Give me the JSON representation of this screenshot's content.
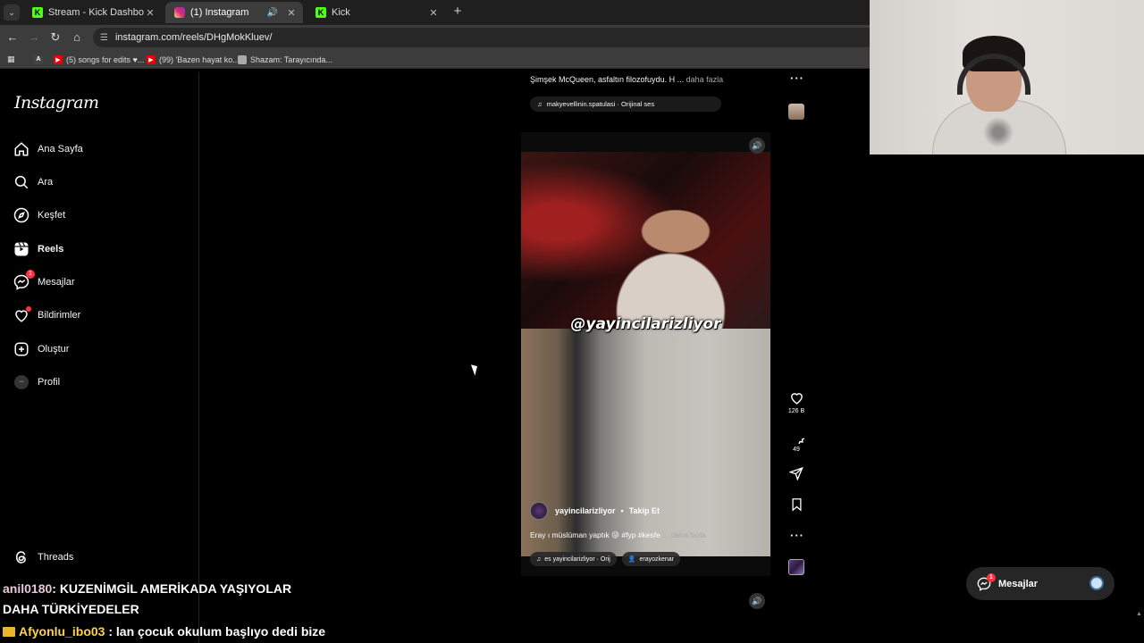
{
  "browser": {
    "tabs": [
      {
        "title": "Stream - Kick Dashboard",
        "favicon": "kick-icon",
        "active": false
      },
      {
        "title": "(1) Instagram",
        "favicon": "instagram-icon",
        "active": true
      },
      {
        "title": "Kick",
        "favicon": "kick-icon",
        "active": false
      }
    ],
    "url": "instagram.com/reels/DHgMokKluev/",
    "bookmarks": [
      {
        "label": "(5) songs for edits ♥...",
        "icon": "youtube-icon"
      },
      {
        "label": "(99) 'Bazen hayat ko...",
        "icon": "youtube-icon"
      },
      {
        "label": "Shazam: Tarayıcında...",
        "icon": "shazam-icon"
      }
    ]
  },
  "sidebar": {
    "logo": "Instagram",
    "items": [
      {
        "label": "Ana Sayfa",
        "icon": "home-icon"
      },
      {
        "label": "Ara",
        "icon": "search-icon"
      },
      {
        "label": "Keşfet",
        "icon": "compass-icon"
      },
      {
        "label": "Reels",
        "icon": "reels-icon",
        "active": true
      },
      {
        "label": "Mesajlar",
        "icon": "messenger-icon",
        "badge": "1"
      },
      {
        "label": "Bildirimler",
        "icon": "heart-icon"
      },
      {
        "label": "Oluştur",
        "icon": "plus-square-icon"
      },
      {
        "label": "Profil",
        "icon": "avatar"
      }
    ],
    "threads": "Threads"
  },
  "feed": {
    "prev_caption": "Şimşek McQueen, asfaltın filozofuydu. H ...",
    "prev_more": "daha fazla",
    "prev_audio": "makyevellinin.spatulasi · Orijinal ses",
    "reel": {
      "overlay_text": "@yayincilarizliyor",
      "username": "yayincilarizliyor",
      "separator": "•",
      "follow": "Takip Et",
      "caption": "Eray ı müslüman yaptık 😜 #fyp #kesfe",
      "more": "... daha fazla",
      "audio": "es   yayincilarizliyor · Orij",
      "tagged": "erayozkenar"
    },
    "actions": {
      "likes": "126 B",
      "comments": "49"
    }
  },
  "messages_button": {
    "label": "Mesajlar",
    "badge": "1"
  },
  "chat": [
    {
      "user": "anil0180",
      "text": ": KUZENİMGİL AMERİKADA YAŞIYOLAR",
      "cont": "DAHA TÜRKİYEDELER"
    },
    {
      "user": "Afyonlu_ibo03",
      "text": " : lan çocuk okulum başlıyo dedi bize"
    }
  ],
  "colors": {
    "background": "#000000",
    "notification": "#ff3040",
    "kick": "#53fc18"
  }
}
